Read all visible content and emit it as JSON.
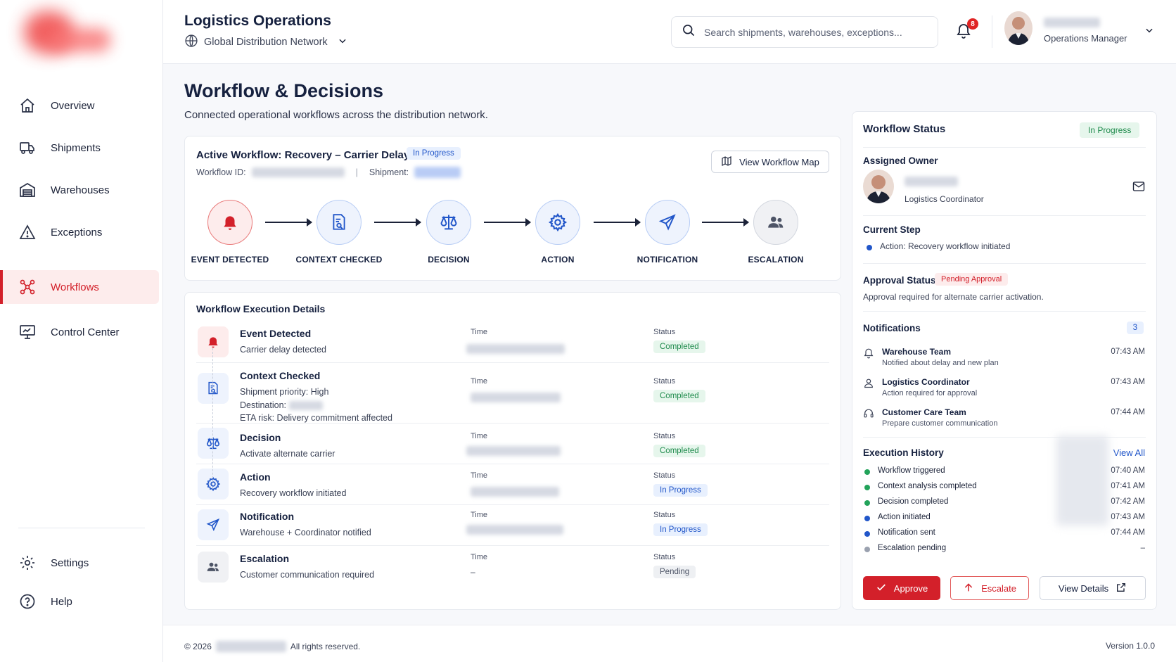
{
  "header": {
    "title": "Logistics Operations",
    "network": "Global Distribution Network",
    "search_placeholder": "Search shipments, warehouses, exceptions...",
    "notification_count": "8",
    "user_role": "Operations Manager"
  },
  "sidebar": {
    "items": [
      {
        "label": "Overview",
        "icon": "home-icon"
      },
      {
        "label": "Shipments",
        "icon": "truck-icon"
      },
      {
        "label": "Warehouses",
        "icon": "warehouse-icon"
      },
      {
        "label": "Exceptions",
        "icon": "warning-icon"
      },
      {
        "label": "Workflows",
        "icon": "workflow-icon",
        "active": true
      },
      {
        "label": "Control Center",
        "icon": "monitor-icon"
      }
    ],
    "bottom_items": [
      {
        "label": "Settings",
        "icon": "gear-icon"
      },
      {
        "label": "Help",
        "icon": "help-icon"
      }
    ]
  },
  "page": {
    "title": "Workflow & Decisions",
    "subtitle": "Connected operational workflows across the distribution network."
  },
  "active_workflow": {
    "title": "Active Workflow: Recovery – Carrier Delay",
    "status": "In Progress",
    "id_label": "Workflow ID:",
    "shipment_label": "Shipment:",
    "map_button": "View Workflow Map",
    "steps": [
      {
        "label": "EVENT DETECTED",
        "icon": "bell-icon"
      },
      {
        "label": "CONTEXT CHECKED",
        "icon": "document-search-icon"
      },
      {
        "label": "DECISION",
        "icon": "scale-icon"
      },
      {
        "label": "ACTION",
        "icon": "gear-icon"
      },
      {
        "label": "NOTIFICATION",
        "icon": "send-icon"
      },
      {
        "label": "ESCALATION",
        "icon": "users-icon"
      }
    ]
  },
  "execution": {
    "title": "Workflow Execution Details",
    "time_label": "Time",
    "status_label": "Status",
    "rows": [
      {
        "name": "Event Detected",
        "desc": "Carrier delay detected",
        "status": "Completed"
      },
      {
        "name": "Context Checked",
        "desc1": "Shipment priority: High",
        "desc2": "Destination:",
        "desc3": "ETA risk: Delivery commitment affected",
        "status": "Completed"
      },
      {
        "name": "Decision",
        "desc": "Activate alternate carrier",
        "status": "Completed"
      },
      {
        "name": "Action",
        "desc": "Recovery workflow initiated",
        "status": "In Progress"
      },
      {
        "name": "Notification",
        "desc": "Warehouse + Coordinator notified",
        "status": "In Progress"
      },
      {
        "name": "Escalation",
        "desc": "Customer communication required",
        "time": "–",
        "status": "Pending"
      }
    ]
  },
  "status_panel": {
    "title": "Workflow Status",
    "status": "In Progress",
    "owner_label": "Assigned Owner",
    "owner_role": "Logistics Coordinator",
    "current_step_label": "Current Step",
    "current_step": "Action: Recovery workflow initiated",
    "approval_label": "Approval Status",
    "approval_status": "Pending Approval",
    "approval_desc": "Approval required for alternate carrier activation.",
    "notifications_label": "Notifications",
    "notifications_count": "3",
    "notifications": [
      {
        "name": "Warehouse Team",
        "desc": "Notified about delay and new plan",
        "time": "07:43 AM"
      },
      {
        "name": "Logistics Coordinator",
        "desc": "Action required for approval",
        "time": "07:43 AM"
      },
      {
        "name": "Customer Care Team",
        "desc": "Prepare customer communication",
        "time": "07:44 AM"
      }
    ],
    "history_label": "Execution History",
    "view_all": "View All",
    "history": [
      {
        "event": "Workflow triggered",
        "time": "07:40 AM",
        "color": "#22a35a"
      },
      {
        "event": "Context analysis completed",
        "time": "07:41 AM",
        "color": "#22a35a"
      },
      {
        "event": "Decision completed",
        "time": "07:42 AM",
        "color": "#22a35a"
      },
      {
        "event": "Action initiated",
        "time": "07:43 AM",
        "color": "#2156c9"
      },
      {
        "event": "Notification sent",
        "time": "07:44 AM",
        "color": "#2156c9"
      },
      {
        "event": "Escalation pending",
        "time": "–",
        "color": "#9aa1af"
      }
    ],
    "approve_btn": "Approve",
    "escalate_btn": "Escalate",
    "details_btn": "View Details"
  },
  "footer": {
    "copyright": "© 2026",
    "rights": "All rights reserved.",
    "version": "Version 1.0.0"
  },
  "colors": {
    "accent": "#d3202a",
    "primary_blue": "#2156c9",
    "success": "#1f8b4c"
  }
}
